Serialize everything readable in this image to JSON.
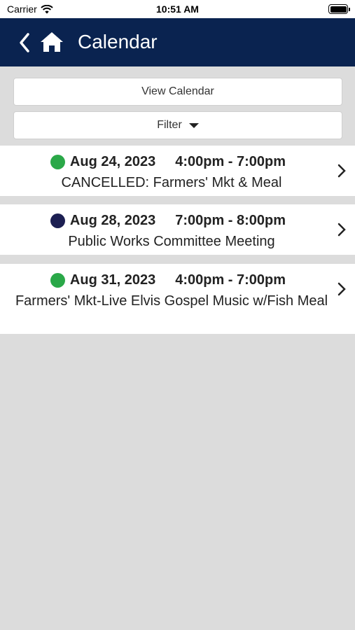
{
  "status_bar": {
    "carrier": "Carrier",
    "time": "10:51 AM"
  },
  "nav": {
    "title": "Calendar"
  },
  "buttons": {
    "view_calendar": "View Calendar",
    "filter": "Filter"
  },
  "events": [
    {
      "date": "Aug 24, 2023",
      "time": "4:00pm - 7:00pm",
      "title": "CANCELLED: Farmers' Mkt & Meal",
      "dot_color": "#2aa848"
    },
    {
      "date": "Aug 28, 2023",
      "time": "7:00pm - 8:00pm",
      "title": "Public Works Committee Meeting",
      "dot_color": "#1c1f52"
    },
    {
      "date": "Aug 31, 2023",
      "time": "4:00pm - 7:00pm",
      "title": "Farmers' Mkt-Live Elvis Gospel Music w/Fish Meal",
      "dot_color": "#2aa848"
    }
  ],
  "colors": {
    "nav_background": "#0a2350",
    "page_background": "#dcdcdc"
  },
  "icons": {
    "wifi": "wifi-icon",
    "battery": "battery-icon",
    "back": "chevron-left-icon",
    "home": "home-icon",
    "caret": "caret-down-icon",
    "disclosure": "chevron-right-icon"
  }
}
